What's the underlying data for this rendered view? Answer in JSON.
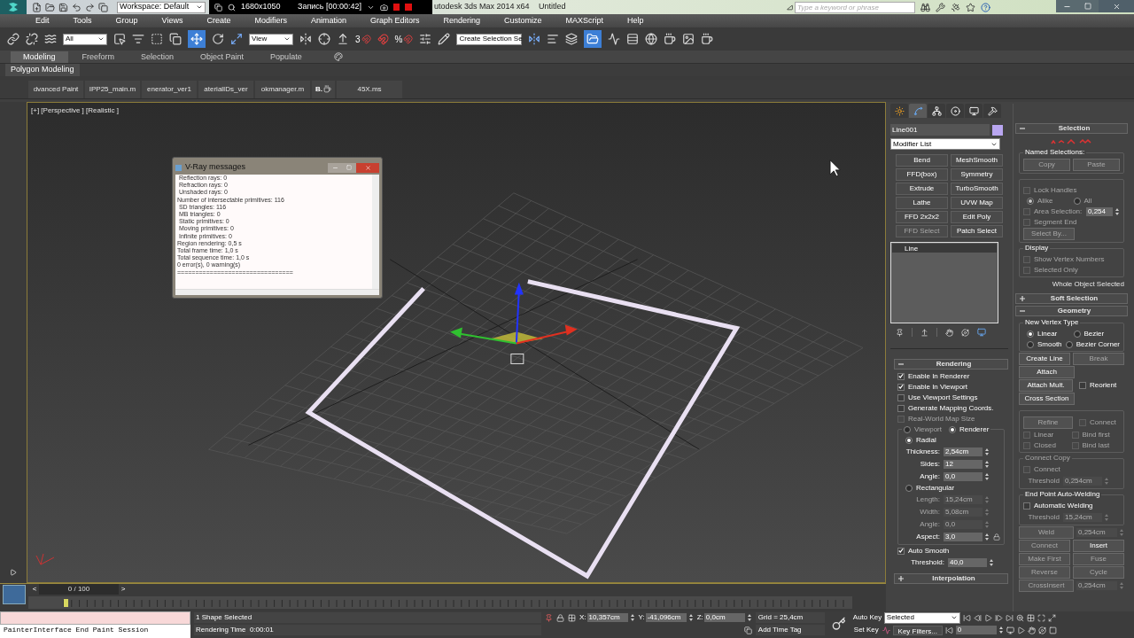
{
  "title_bar": {
    "workspace": "Workspace: Default",
    "recorder": {
      "resolution": "1680x1050",
      "status": "Запись [00:00:42]"
    },
    "app_title": "utodesk 3ds Max  2014 x64",
    "document": "Untitled",
    "search": {
      "placeholder": "Type a keyword or phrase"
    }
  },
  "menu": [
    "Edit",
    "Tools",
    "Group",
    "Views",
    "Create",
    "Modifiers",
    "Animation",
    "Graph Editors",
    "Rendering",
    "Customize",
    "MAXScript",
    "Help"
  ],
  "toolbar": {
    "selection_filter": "All",
    "reference_coordinates": "View",
    "snap_label": "3",
    "percent_snap_label": "%",
    "named_selection": "Create Selection Se"
  },
  "ribbon": {
    "tabs": [
      {
        "label": "Modeling",
        "selected": true
      },
      {
        "label": "Freeform",
        "selected": false
      },
      {
        "label": "Selection",
        "selected": false
      },
      {
        "label": "Object Paint",
        "selected": false
      },
      {
        "label": "Populate",
        "selected": false
      }
    ],
    "panel": "Polygon Modeling"
  },
  "script_buttons": [
    {
      "kind": "text",
      "label": "dvanced Paint"
    },
    {
      "kind": "text",
      "label": "IPP25_main.m"
    },
    {
      "kind": "text",
      "label": "enerator_ver1"
    },
    {
      "kind": "text",
      "label": "aterialIDs_ver"
    },
    {
      "kind": "text",
      "label": "okmanager.m"
    },
    {
      "kind": "teapot",
      "label": "B."
    },
    {
      "kind": "text",
      "label": "45X.ms"
    }
  ],
  "viewport": {
    "label": "[+] [Perspective ] [Realistic ]"
  },
  "vray_window": {
    "title": "V-Ray messages",
    "lines": [
      " Reflection rays: 0",
      " Refraction rays: 0",
      " Unshaded rays: 0",
      "Number of intersectable primitives: 116",
      " SD triangles: 116",
      " MB triangles: 0",
      " Static primitives: 0",
      " Moving primitives: 0",
      " Infinite primitives: 0",
      "Region rendering: 0,5 s",
      "Total frame time: 1,0 s",
      "Total sequence time: 1,0 s",
      "0 error(s), 0 warning(s)",
      "================================"
    ]
  },
  "command_panel": {
    "tabs": [
      {
        "selected": false
      },
      {
        "selected": true
      },
      {
        "selected": false
      },
      {
        "selected": false
      },
      {
        "selected": false
      },
      {
        "selected": false
      }
    ],
    "object_name": "Line001",
    "modifier_list": "Modifier List",
    "modifier_buttons": [
      {
        "label": "Bend",
        "disabled": false
      },
      {
        "label": "MeshSmooth",
        "disabled": false
      },
      {
        "label": "FFD(box)",
        "disabled": false
      },
      {
        "label": "Symmetry",
        "disabled": false
      },
      {
        "label": "Extrude",
        "disabled": false
      },
      {
        "label": "TurboSmooth",
        "disabled": false
      },
      {
        "label": "Lathe",
        "disabled": false
      },
      {
        "label": "UVW Map",
        "disabled": false
      },
      {
        "label": "FFD 2x2x2",
        "disabled": false
      },
      {
        "label": "Edit Poly",
        "disabled": false
      },
      {
        "label": "FFD Select",
        "disabled": true
      },
      {
        "label": "Patch Select",
        "disabled": false
      }
    ],
    "stack": [
      {
        "label": "Line",
        "selected": false
      }
    ],
    "left_rollouts": [
      {
        "title": "Rendering",
        "expanded": true,
        "rows": [
          {
            "kind": "checkbox",
            "label": "Enable In Renderer",
            "checked": true,
            "disabled": false
          },
          {
            "kind": "checkbox",
            "label": "Enable In Viewport",
            "checked": true,
            "disabled": false
          },
          {
            "kind": "checkbox",
            "label": "Use Viewport Settings",
            "checked": false,
            "disabled": false
          },
          {
            "kind": "checkbox",
            "label": "Generate Mapping Coords.",
            "checked": false,
            "disabled": false
          },
          {
            "kind": "checkbox",
            "label": "Real-World Map Size",
            "checked": false,
            "disabled": true
          },
          {
            "kind": "group",
            "header": [
              {
                "label": "Viewport",
                "selected": false,
                "disabled": true
              },
              {
                "label": "Renderer",
                "selected": true,
                "disabled": false
              }
            ],
            "rows": [
              {
                "kind": "radios",
                "options": [
                  {
                    "label": "Radial",
                    "selected": true,
                    "disabled": false
                  }
                ]
              },
              {
                "kind": "spinner",
                "label": "Thickness:",
                "value": "2,54cm",
                "disabled": false
              },
              {
                "kind": "spinner",
                "label": "Sides:",
                "value": "12",
                "disabled": false
              },
              {
                "kind": "spinner",
                "label": "Angle:",
                "value": "0,0",
                "disabled": false
              },
              {
                "kind": "radios",
                "options": [
                  {
                    "label": "Rectangular",
                    "selected": false,
                    "disabled": false
                  }
                ]
              },
              {
                "kind": "spinner",
                "label": "Length:",
                "value": "15,24cm",
                "disabled": true
              },
              {
                "kind": "spinner",
                "label": "Width:",
                "value": "5,08cm",
                "disabled": true
              },
              {
                "kind": "spinner",
                "label": "Angle:",
                "value": "0,0",
                "disabled": true
              },
              {
                "kind": "aspect",
                "label": "Aspect:",
                "value": "3,0",
                "disabled": false
              }
            ]
          },
          {
            "kind": "checkbox",
            "label": "Auto Smooth",
            "checked": true,
            "disabled": false
          },
          {
            "kind": "spinner",
            "label": "Threshold:",
            "value": "40,0",
            "disabled": false
          }
        ]
      },
      {
        "title": "Interpolation",
        "expanded": false
      }
    ],
    "right_rollouts": [
      {
        "title": "Selection",
        "expanded": true,
        "rows": [
          {
            "kind": "level_icons"
          },
          {
            "kind": "group",
            "title": "Named Selections:",
            "rows": [
              {
                "kind": "buttons",
                "items": [
                  {
                    "label": "Copy",
                    "disabled": true
                  },
                  {
                    "label": "Paste",
                    "disabled": true
                  }
                ]
              }
            ]
          },
          {
            "kind": "group",
            "rows": [
              {
                "kind": "checkbox",
                "label": "Lock Handles",
                "checked": false,
                "disabled": true
              },
              {
                "kind": "radios",
                "options": [
                  {
                    "label": "Alike",
                    "selected": true,
                    "disabled": true
                  },
                  {
                    "label": "All",
                    "selected": false,
                    "disabled": true
                  }
                ]
              },
              {
                "kind": "checkbox_spinner",
                "label": "Area Selection:",
                "checked": false,
                "disabled": true,
                "value": "0,254"
              },
              {
                "kind": "checkbox",
                "label": "Segment End",
                "checked": false,
                "disabled": true
              },
              {
                "kind": "buttons",
                "items": [
                  {
                    "label": "Select By...",
                    "disabled": true
                  }
                ]
              }
            ]
          },
          {
            "kind": "group",
            "title": "Display",
            "rows": [
              {
                "kind": "checkbox",
                "label": "Show Vertex Numbers",
                "checked": false,
                "disabled": true
              },
              {
                "kind": "checkbox",
                "label": "Selected Only",
                "checked": false,
                "disabled": true
              }
            ]
          },
          {
            "kind": "text",
            "text": "Whole Object Selected"
          }
        ]
      },
      {
        "title": "Soft Selection",
        "expanded": false
      },
      {
        "title": "Geometry",
        "expanded": true,
        "rows": [
          {
            "kind": "group",
            "title": "New Vertex Type",
            "rows": [
              {
                "kind": "radios",
                "options": [
                  {
                    "label": "Linear",
                    "selected": true,
                    "disabled": false
                  },
                  {
                    "label": "Bezier",
                    "selected": false,
                    "disabled": false
                  }
                ]
              },
              {
                "kind": "radios",
                "options": [
                  {
                    "label": "Smooth",
                    "selected": false,
                    "disabled": false
                  },
                  {
                    "label": "Bezier Corner",
                    "selected": false,
                    "disabled": false
                  }
                ]
              }
            ]
          },
          {
            "kind": "buttons",
            "items": [
              {
                "label": "Create Line",
                "disabled": false
              },
              {
                "label": "Break",
                "disabled": true
              }
            ]
          },
          {
            "kind": "buttons",
            "items": [
              {
                "label": "Attach",
                "disabled": false
              }
            ]
          },
          {
            "kind": "button_checkbox",
            "button": {
              "label": "Attach Mult.",
              "disabled": false
            },
            "checkbox": {
              "label": "Reorient",
              "checked": false,
              "disabled": false
            }
          },
          {
            "kind": "buttons",
            "items": [
              {
                "label": "Cross Section",
                "disabled": false
              }
            ]
          },
          {
            "kind": "group",
            "rows": [
              {
                "kind": "button_checkbox",
                "button": {
                  "label": "Refine",
                  "disabled": true
                },
                "checkbox": {
                  "label": "Connect",
                  "checked": false,
                  "disabled": true
                }
              },
              {
                "kind": "checkboxes",
                "items": [
                  {
                    "label": "Linear",
                    "checked": false,
                    "disabled": true
                  },
                  {
                    "label": "Bind first",
                    "checked": false,
                    "disabled": true
                  }
                ]
              },
              {
                "kind": "checkboxes",
                "items": [
                  {
                    "label": "Closed",
                    "checked": false,
                    "disabled": true
                  },
                  {
                    "label": "Bind last",
                    "checked": false,
                    "disabled": true
                  }
                ]
              }
            ]
          },
          {
            "kind": "group",
            "title": "Connect Copy",
            "title_disabled": true,
            "rows": [
              {
                "kind": "checkbox",
                "label": "Connect",
                "checked": false,
                "disabled": true
              },
              {
                "kind": "spinner",
                "label": "Threshold",
                "value": "0,254cm",
                "disabled": true
              }
            ]
          },
          {
            "kind": "group",
            "title": "End Point Auto-Welding",
            "title_disabled": false,
            "rows": [
              {
                "kind": "checkbox",
                "label": "Automatic Welding",
                "checked": false,
                "disabled": false
              },
              {
                "kind": "spinner",
                "label": "Threshold",
                "value": "15,24cm",
                "disabled": true
              }
            ]
          },
          {
            "kind": "button_spinner",
            "button": {
              "label": "Weld",
              "disabled": true
            },
            "value": "0,254cm",
            "disabled": true
          },
          {
            "kind": "buttons",
            "items": [
              {
                "label": "Connect",
                "disabled": true
              },
              {
                "label": "Insert",
                "disabled": false
              }
            ]
          },
          {
            "kind": "buttons",
            "items": [
              {
                "label": "Make First",
                "disabled": true
              },
              {
                "label": "Fuse",
                "disabled": true
              }
            ]
          },
          {
            "kind": "buttons",
            "items": [
              {
                "label": "Reverse",
                "disabled": true
              },
              {
                "label": "Cycle",
                "disabled": true
              }
            ]
          },
          {
            "kind": "button_spinner",
            "button": {
              "label": "CrossInsert",
              "disabled": true
            },
            "value": "0,254cm",
            "disabled": true
          }
        ]
      }
    ]
  },
  "timeline": {
    "position": "0 / 100",
    "level": 0,
    "previous": "<",
    "next": ">"
  },
  "listener": {
    "output": "PainterInterface End Paint Session"
  },
  "status_bar": {
    "selection": "1 Shape Selected",
    "prompt": "Rendering Time  0:00:01",
    "coordinates": [
      {
        "axis": "X:",
        "value": "10,357cm"
      },
      {
        "axis": "Y:",
        "value": "-41,096cm"
      },
      {
        "axis": "Z:",
        "value": "0,0cm"
      }
    ],
    "grid": "Grid = 25,4cm",
    "time_tag": "Add Time Tag",
    "auto_key": "Auto Key",
    "key_mode": "Selected",
    "set_key": "Set Key",
    "key_filters": "Key Filters...",
    "frame": "0"
  }
}
